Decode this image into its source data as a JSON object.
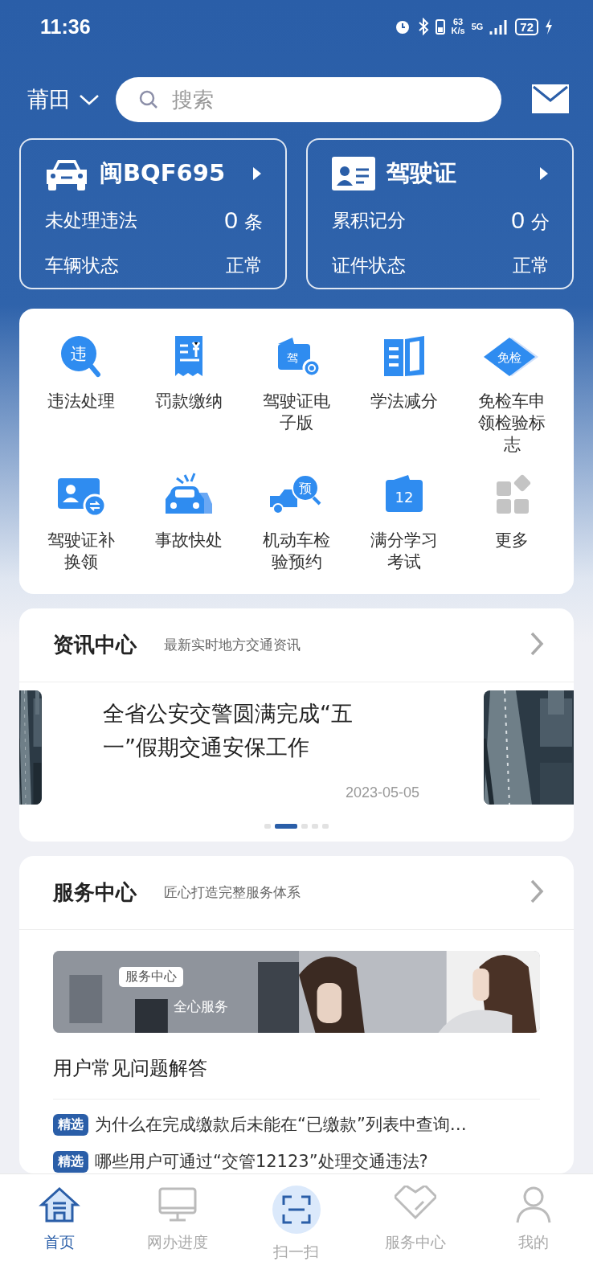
{
  "status_bar": {
    "time": "11:36",
    "speed_value": "63",
    "speed_unit": "K/s",
    "network": "5G",
    "battery": "72"
  },
  "header": {
    "city": "莆田",
    "search": {
      "placeholder": "搜索"
    }
  },
  "summary_cards": [
    {
      "kind": "vehicle",
      "title": "闽BQF695",
      "rows": [
        {
          "label": "未处理违法",
          "value": "0",
          "unit": "条"
        },
        {
          "label": "车辆状态",
          "value": "正常"
        }
      ]
    },
    {
      "kind": "license",
      "title": "驾驶证",
      "rows": [
        {
          "label": "累积记分",
          "value": "0",
          "unit": "分"
        },
        {
          "label": "证件状态",
          "value": "正常"
        }
      ]
    }
  ],
  "services": [
    {
      "kind": "violation",
      "label": "违法处理",
      "icon_text": "违"
    },
    {
      "kind": "fine",
      "label": "罚款缴纳"
    },
    {
      "kind": "elicense",
      "label": "驾驶证电子版",
      "icon_text": "驾"
    },
    {
      "kind": "study",
      "label": "学法减分"
    },
    {
      "kind": "exempt",
      "label": "免检车申领检验标志",
      "icon_text": "免检"
    },
    {
      "kind": "renew",
      "label": "驾驶证补换领"
    },
    {
      "kind": "accident",
      "label": "事故快处"
    },
    {
      "kind": "booking",
      "label": "机动车检验预约",
      "icon_text": "预"
    },
    {
      "kind": "exam",
      "label": "满分学习考试",
      "icon_text": "12"
    },
    {
      "kind": "more",
      "label": "更多"
    }
  ],
  "news": {
    "title": "资讯中心",
    "subtitle": "最新实时地方交通资讯",
    "article": {
      "headline": "全省公安交警圆满完成“五一”假期交通安保工作",
      "date": "2023-05-05"
    },
    "pager": [
      {
        "selected": false
      },
      {
        "selected": true
      },
      {
        "selected": false
      },
      {
        "selected": false
      },
      {
        "selected": false
      }
    ]
  },
  "service_center": {
    "title": "服务中心",
    "subtitle": "匠心打造完整服务体系",
    "banner": {
      "tag": "服务中心",
      "caption": "全心服务"
    },
    "faq_title": "用户常见问题解答",
    "questions": [
      {
        "tag": "精选",
        "text": "为什么在完成缴款后未能在“已缴款”列表中查询…"
      },
      {
        "tag": "精选",
        "text": "哪些用户可通过“交管12123”处理交通违法?"
      }
    ]
  },
  "bottom_nav": [
    {
      "kind": "home",
      "label": "首页",
      "selected": true
    },
    {
      "kind": "progress",
      "label": "网办进度",
      "selected": false
    },
    {
      "kind": "scan",
      "label": "扫一扫",
      "selected": false
    },
    {
      "kind": "service",
      "label": "服务中心",
      "selected": false
    },
    {
      "kind": "me",
      "label": "我的",
      "selected": false
    }
  ]
}
